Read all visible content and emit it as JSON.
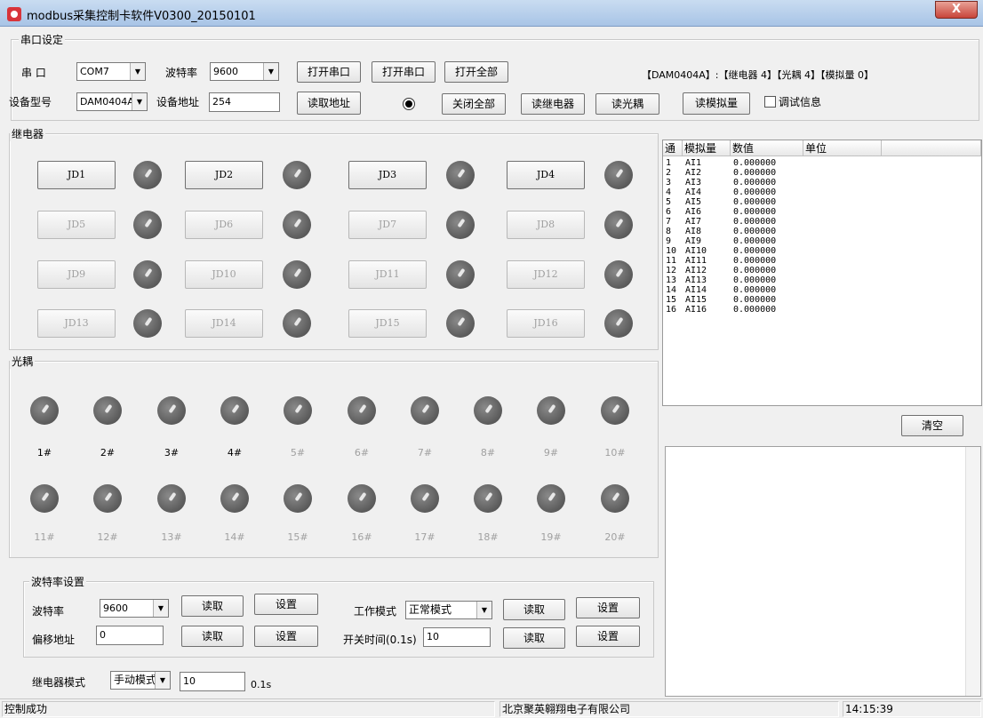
{
  "window": {
    "title": "modbus采集控制卡软件V0300_20150101",
    "close": "X"
  },
  "serial": {
    "group_title": "串口设定",
    "port_label": "串  口",
    "port_value": "COM7",
    "baud_label": "波特率",
    "baud_value": "9600",
    "btn_open1": "打开串口",
    "btn_open2": "打开串口",
    "btn_open_all": "打开全部",
    "info": "【DAM0404A】:【继电器  4】【光耦 4】【模拟量 0】",
    "model_label": "设备型号",
    "model_value": "DAM0404A",
    "addr_label": "设备地址",
    "addr_value": "254",
    "btn_read_addr": "读取地址",
    "btn_close_all": "关闭全部",
    "btn_read_relay": "读继电器",
    "btn_read_opto": "读光耦",
    "btn_read_analog": "读模拟量",
    "debug_label": "调试信息"
  },
  "relay": {
    "group_title": "继电器",
    "buttons": [
      "JD1",
      "JD2",
      "JD3",
      "JD4",
      "JD5",
      "JD6",
      "JD7",
      "JD8",
      "JD9",
      "JD10",
      "JD11",
      "JD12",
      "JD13",
      "JD14",
      "JD15",
      "JD16"
    ]
  },
  "opto": {
    "group_title": "光耦",
    "labels": [
      "1#",
      "2#",
      "3#",
      "4#",
      "5#",
      "6#",
      "7#",
      "8#",
      "9#",
      "10#",
      "11#",
      "12#",
      "13#",
      "14#",
      "15#",
      "16#",
      "17#",
      "18#",
      "19#",
      "20#"
    ]
  },
  "baud_settings": {
    "group_title": "波特率设置",
    "baud_label": "波特率",
    "baud_value": "9600",
    "offset_label": "偏移地址",
    "offset_value": "0",
    "read": "读取",
    "set": "设置",
    "mode_label": "工作模式",
    "mode_value": "正常模式",
    "switch_time_label": "开关时间(0.1s)",
    "switch_time_value": "10"
  },
  "relay_mode": {
    "label": "继电器模式",
    "value": "手动模式",
    "time_value": "10",
    "unit": "0.1s"
  },
  "ai_table": {
    "headers": [
      "通",
      "模拟量",
      "数值",
      "单位"
    ],
    "rows": [
      [
        "1",
        "AI1",
        "0.000000",
        ""
      ],
      [
        "2",
        "AI2",
        "0.000000",
        ""
      ],
      [
        "3",
        "AI3",
        "0.000000",
        ""
      ],
      [
        "4",
        "AI4",
        "0.000000",
        ""
      ],
      [
        "5",
        "AI5",
        "0.000000",
        ""
      ],
      [
        "6",
        "AI6",
        "0.000000",
        ""
      ],
      [
        "7",
        "AI7",
        "0.000000",
        ""
      ],
      [
        "8",
        "AI8",
        "0.000000",
        ""
      ],
      [
        "9",
        "AI9",
        "0.000000",
        ""
      ],
      [
        "10",
        "AI10",
        "0.000000",
        ""
      ],
      [
        "11",
        "AI11",
        "0.000000",
        ""
      ],
      [
        "12",
        "AI12",
        "0.000000",
        ""
      ],
      [
        "13",
        "AI13",
        "0.000000",
        ""
      ],
      [
        "14",
        "AI14",
        "0.000000",
        ""
      ],
      [
        "15",
        "AI15",
        "0.000000",
        ""
      ],
      [
        "16",
        "AI16",
        "0.000000",
        ""
      ]
    ]
  },
  "clear_button": "清空",
  "status": {
    "message": "控制成功",
    "company": "北京聚英翱翔电子有限公司",
    "time": "14:15:39"
  }
}
